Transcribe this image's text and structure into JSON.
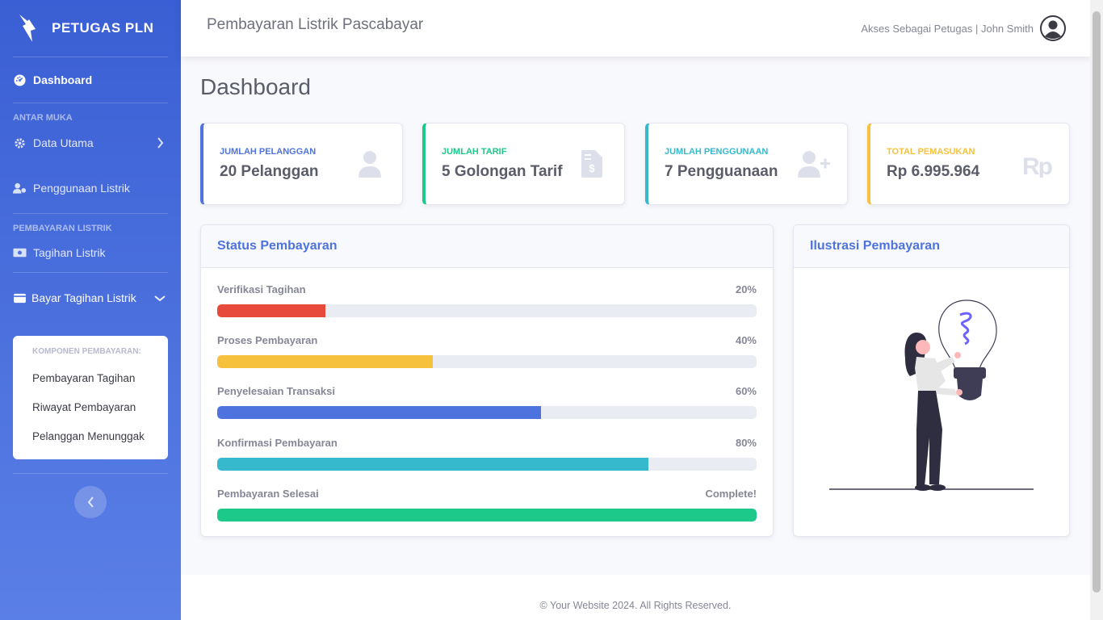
{
  "sidebar": {
    "brand": "PETUGAS PLN",
    "dashboard": "Dashboard",
    "heading_interface": "ANTAR MUKA",
    "data_utama": "Data Utama",
    "penggunaan": "Penggunaan Listrik",
    "heading_payment": "PEMBAYARAN LISTRIK",
    "tagihan": "Tagihan Listrik",
    "bayar": "Bayar Tagihan Listrik",
    "submenu": {
      "heading": "KOMPONEN PEMBAYARAN:",
      "items": [
        "Pembayaran Tagihan",
        "Riwayat Pembayaran",
        "Pelanggan Menunggak"
      ]
    }
  },
  "topbar": {
    "title": "Pembayaran Listrik Pascabayar",
    "user": "Akses Sebagai Petugas | John Smith"
  },
  "page_title": "Dashboard",
  "stats": [
    {
      "label": "JUMLAH PELANGGAN",
      "value": "20 Pelanggan",
      "color": "#4e73df",
      "icon": "user-icon"
    },
    {
      "label": "JUMLAH TARIF",
      "value": "5 Golongan Tarif",
      "color": "#1cc88a",
      "icon": "invoice-dollar-icon"
    },
    {
      "label": "JUMLAH PENGGUNAAN",
      "value": "7 Pengguanaan",
      "color": "#36b9cc",
      "icon": "user-plus-icon"
    },
    {
      "label": "TOTAL PEMASUKAN",
      "value": "Rp 6.995.964",
      "color": "#f6c23e",
      "icon": "rupiah-icon"
    }
  ],
  "status": {
    "title": "Status Pembayaran",
    "items": [
      {
        "label": "Verifikasi Tagihan",
        "value": "20%",
        "progress": 0.2,
        "color": "#e74a3b"
      },
      {
        "label": "Proses Pembayaran",
        "value": "40%",
        "progress": 0.4,
        "color": "#f6c23e"
      },
      {
        "label": "Penyelesaian Transaksi",
        "value": "60%",
        "progress": 0.6,
        "color": "#4e73df"
      },
      {
        "label": "Konfirmasi Pembayaran",
        "value": "80%",
        "progress": 0.8,
        "color": "#36b9cc"
      },
      {
        "label": "Pembayaran Selesai",
        "value": "Complete!",
        "progress": 1.0,
        "color": "#1cc88a"
      }
    ]
  },
  "illustration": {
    "title": "Ilustrasi Pembayaran"
  },
  "footer": "© Your Website 2024. All Rights Reserved."
}
